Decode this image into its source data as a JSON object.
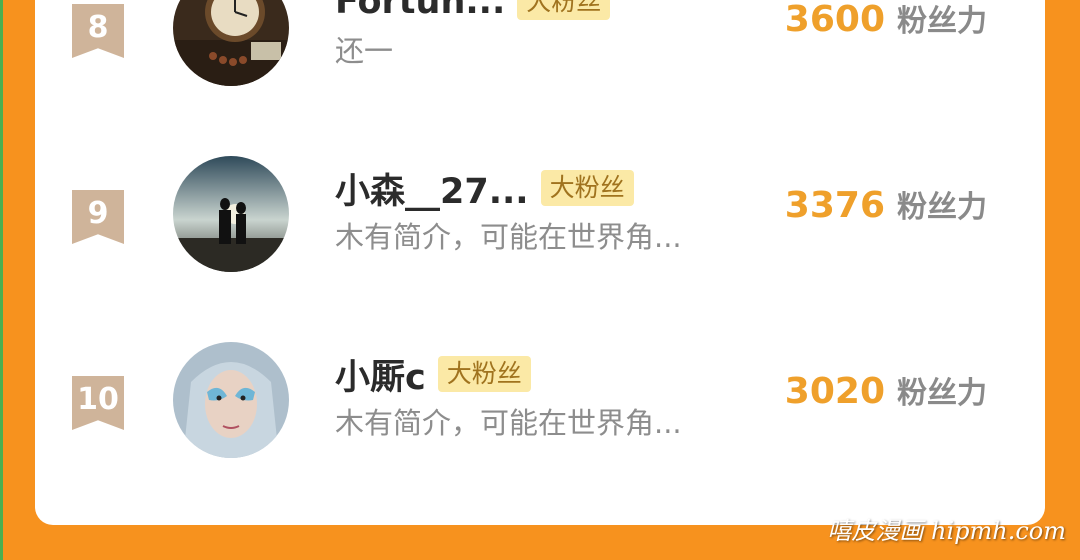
{
  "rankings": [
    {
      "rank": "8",
      "name": "Fortun...",
      "badge": "大粉丝",
      "bio": "还一",
      "score": "3600",
      "score_unit": "粉丝力",
      "avatar": "clock-photo"
    },
    {
      "rank": "9",
      "name": "小森__27...",
      "badge": "大粉丝",
      "bio": "木有简介，可能在世界角...",
      "score": "3376",
      "score_unit": "粉丝力",
      "avatar": "couple-silhouette-photo"
    },
    {
      "rank": "10",
      "name": "小厮c",
      "badge": "大粉丝",
      "bio": "木有简介，可能在世界角...",
      "score": "3020",
      "score_unit": "粉丝力",
      "avatar": "character-portrait-photo"
    }
  ],
  "watermark": "嘻皮漫画 hipmh.com",
  "colors": {
    "background": "#f7921e",
    "score": "#efa02b",
    "rank_ribbon": "#cfb49a",
    "badge_bg": "#fbe9a6"
  }
}
